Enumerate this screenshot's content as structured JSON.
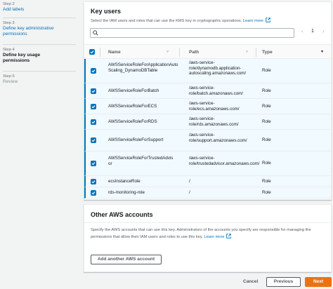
{
  "wizard": {
    "steps": [
      {
        "num": "Step 2",
        "title": "Add labels",
        "state": "link"
      },
      {
        "num": "Step 3",
        "title": "Define key administrative permissions",
        "state": "link"
      },
      {
        "num": "Step 4",
        "title": "Define key usage permissions",
        "state": "current"
      },
      {
        "num": "Step 5",
        "title": "Review",
        "state": "disabled"
      }
    ]
  },
  "key_users": {
    "title": "Key users",
    "description": "Select the IAM users and roles that can use the KMS key in cryptographic operations.",
    "learn_more": "Learn more",
    "search_placeholder": "",
    "page": "1",
    "prev_icon": "chevron-left-icon",
    "next_icon": "chevron-right-icon",
    "columns": {
      "name": "Name",
      "path": "Path",
      "type": "Type"
    },
    "rows": [
      {
        "name": "AWSServiceRoleForApplicationAutoScaling_DynamoDBTable",
        "path": "/aws-service-role/dynamodb.application-autoscaling.amazonaws.com/",
        "type": "Role",
        "checked": true
      },
      {
        "name": "AWSServiceRoleForBatch",
        "path": "/aws-service-role/batch.amazonaws.com/",
        "type": "Role",
        "checked": true
      },
      {
        "name": "AWSServiceRoleForECS",
        "path": "/aws-service-role/ecs.amazonaws.com/",
        "type": "Role",
        "checked": true
      },
      {
        "name": "AWSServiceRoleForRDS",
        "path": "/aws-service-role/rds.amazonaws.com/",
        "type": "Role",
        "checked": true
      },
      {
        "name": "AWSServiceRoleForSupport",
        "path": "/aws-service-role/support.amazonaws.com/",
        "type": "Role",
        "checked": true
      },
      {
        "name": "AWSServiceRoleForTrustedAdvisor",
        "path": "/aws-service-role/trustedadvisor.amazonaws.com/",
        "type": "Role",
        "checked": true
      },
      {
        "name": "ecsInstanceRole",
        "path": "/",
        "type": "Role",
        "checked": true
      },
      {
        "name": "rds-monitoring-role",
        "path": "/",
        "type": "Role",
        "checked": true
      }
    ]
  },
  "other_accounts": {
    "title": "Other AWS accounts",
    "description": "Specify the AWS accounts that can use this key. Administrators of the accounts you specify are responsible for managing the permissions that allow their IAM users and roles to use this key.",
    "learn_more": "Learn more",
    "add_button": "Add another AWS account"
  },
  "footer": {
    "cancel": "Cancel",
    "previous": "Previous",
    "next": "Next"
  },
  "colors": {
    "accent": "#0073bb",
    "primary_button": "#ec7211",
    "selected_row": "#f1faff"
  }
}
